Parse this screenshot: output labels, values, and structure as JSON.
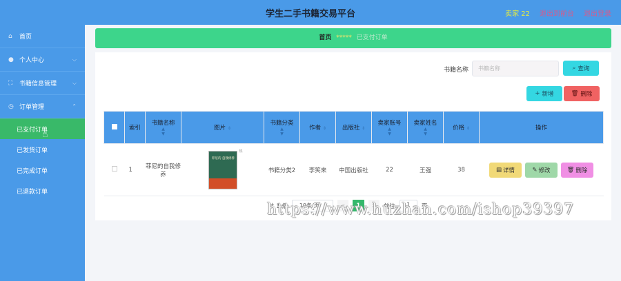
{
  "header": {
    "title": "学生二手书籍交易平台",
    "user": "卖家 22",
    "back_label": "退出到前台",
    "logout_label": "退出登录"
  },
  "sidebar": {
    "items": [
      {
        "label": "首页",
        "icon": "home-icon"
      },
      {
        "label": "个人中心",
        "icon": "user-icon"
      },
      {
        "label": "书籍信息管理",
        "icon": "expand-icon"
      },
      {
        "label": "订单管理",
        "icon": "clock-icon"
      }
    ],
    "subitems": [
      "已支付订单",
      "已发货订单",
      "已完成订单",
      "已退款订单"
    ],
    "active": "已支付订单"
  },
  "breadcrumb": {
    "home": "首页",
    "separator": "*****",
    "current": "已支付订单"
  },
  "search": {
    "label": "书籍名称",
    "placeholder": "书籍名称",
    "button": "查询"
  },
  "toolbar": {
    "add_label": "新增",
    "delete_label": "删除"
  },
  "table": {
    "columns": [
      "索引",
      "书籍名称",
      "图片",
      "书籍分类",
      "作者",
      "出版社",
      "卖家账号",
      "卖家姓名",
      "价格",
      "操作"
    ],
    "rows": [
      {
        "index": "1",
        "name": "菲尼的自我修养",
        "image_title": "菲尼的 自我修养",
        "image_tag": "热",
        "category": "书籍分类2",
        "author": "李笑来",
        "publisher": "中国出版社",
        "seller_account": "22",
        "seller_name": "王强",
        "price": "38",
        "actions": {
          "detail": "详情",
          "edit": "修改",
          "delete": "删除"
        }
      }
    ]
  },
  "pagination": {
    "total": "共 1 条",
    "page_size": "10条/页",
    "prev": "<",
    "current": "1",
    "next": ">",
    "goto_label": "前往",
    "goto_value": "1",
    "page_suffix": "页"
  },
  "watermark": "https://www.huzhan.com/ishop39397",
  "colors": {
    "header": "#4a9ae8",
    "active_menu": "#39b969",
    "breadcrumb_bg": "#3dd58b",
    "accent_cyan": "#34d7e2",
    "danger": "#f06262"
  }
}
